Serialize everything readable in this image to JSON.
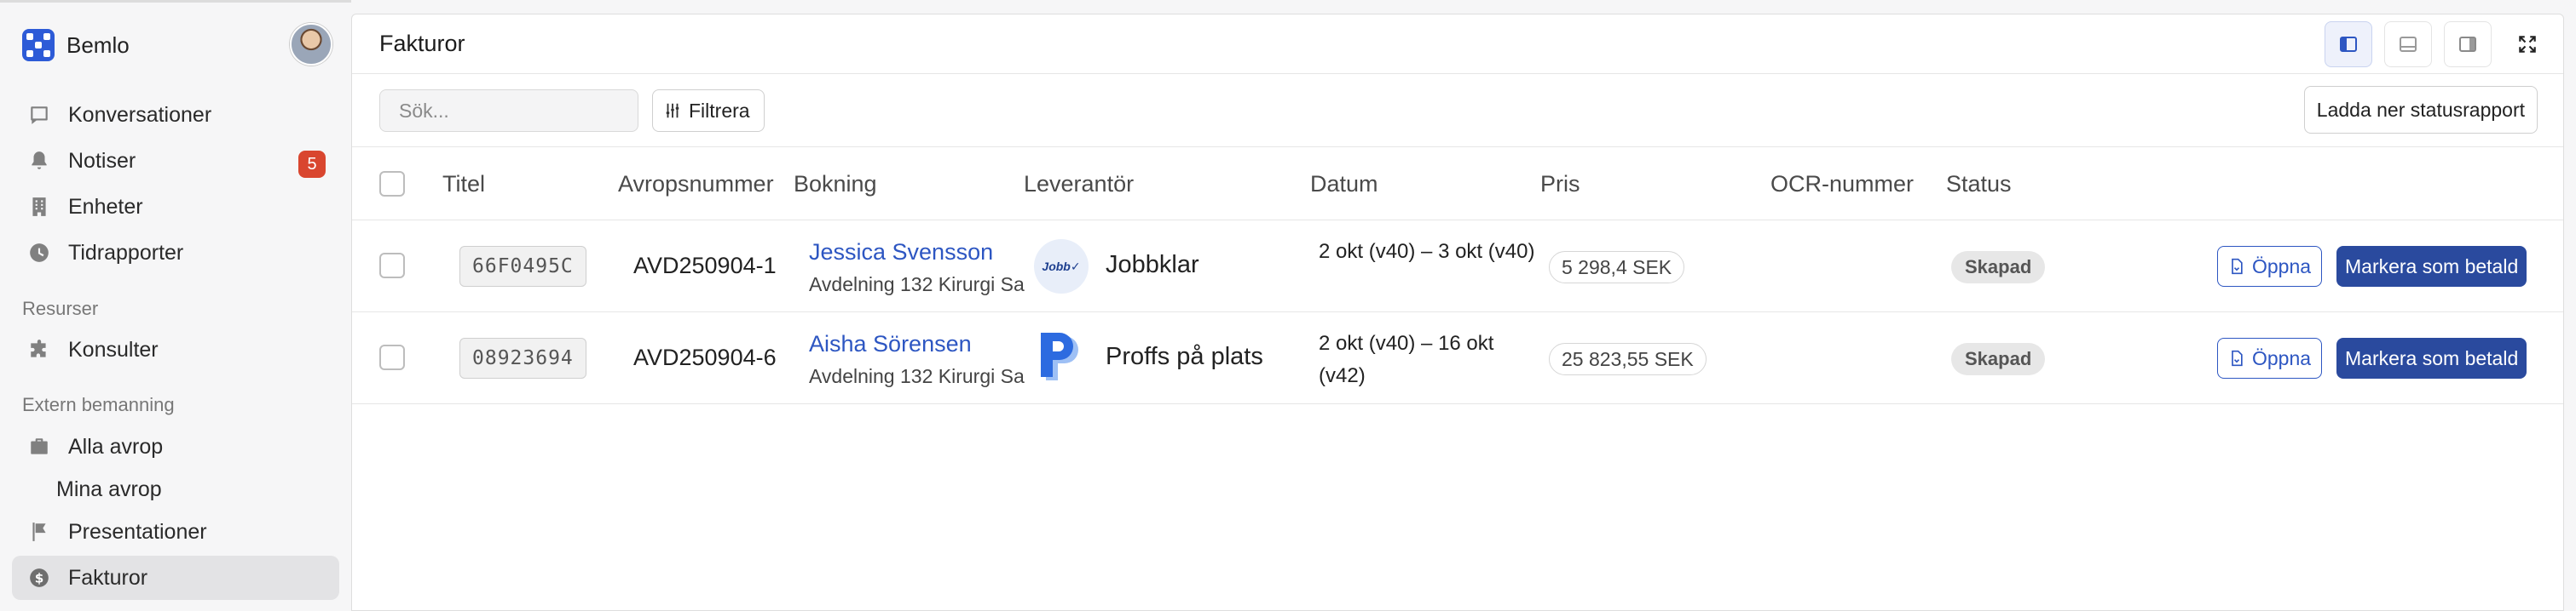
{
  "app": {
    "name": "Bemlo"
  },
  "sidebar": {
    "items": [
      {
        "label": "Konversationer",
        "icon": "inbox-icon"
      },
      {
        "label": "Notiser",
        "icon": "bell-icon",
        "badge": "5"
      },
      {
        "label": "Enheter",
        "icon": "building-icon"
      },
      {
        "label": "Tidrapporter",
        "icon": "clock-icon"
      }
    ],
    "resources_label": "Resurser",
    "resources": [
      {
        "label": "Konsulter",
        "icon": "puzzle-icon"
      }
    ],
    "extern_label": "Extern bemanning",
    "extern": [
      {
        "label": "Alla avrop",
        "icon": "briefcase-icon"
      },
      {
        "label": "Mina avrop"
      },
      {
        "label": "Presentationer",
        "icon": "flag-icon"
      },
      {
        "label": "Fakturor",
        "icon": "dollar-icon",
        "active": true
      }
    ]
  },
  "header": {
    "title": "Fakturor"
  },
  "toolbar": {
    "search_placeholder": "Sök...",
    "filter_label": "Filtrera",
    "report_label": "Ladda ner statusrapport"
  },
  "table": {
    "columns": [
      "Titel",
      "Avropsnummer",
      "Bokning",
      "Leverantör",
      "Datum",
      "Pris",
      "OCR-nummer",
      "Status"
    ],
    "rows": [
      {
        "title": "66F0495C",
        "avrop": "AVD250904-1",
        "booking_name": "Jessica Svensson",
        "booking_sub": "Avdelning 132 Kirurgi Sa",
        "supplier": "Jobbklar",
        "supplier_logo_text": "Jobb✓",
        "date": "2 okt (v40) – 3 okt (v40)",
        "price": "5 298,4 SEK",
        "ocr": "",
        "status": "Skapad",
        "open_label": "Öppna",
        "paid_label": "Markera som betald"
      },
      {
        "title": "08923694",
        "avrop": "AVD250904-6",
        "booking_name": "Aisha Sörensen",
        "booking_sub": "Avdelning 132 Kirurgi Sa",
        "supplier": "Proffs på plats",
        "date": "2 okt (v40) – 16 okt (v42)",
        "price": "25 823,55 SEK",
        "ocr": "",
        "status": "Skapad",
        "open_label": "Öppna",
        "paid_label": "Markera som betald"
      }
    ]
  },
  "colors": {
    "accent": "#2d56c2",
    "primary_button": "#2a4a9e",
    "badge": "#d9462f"
  }
}
